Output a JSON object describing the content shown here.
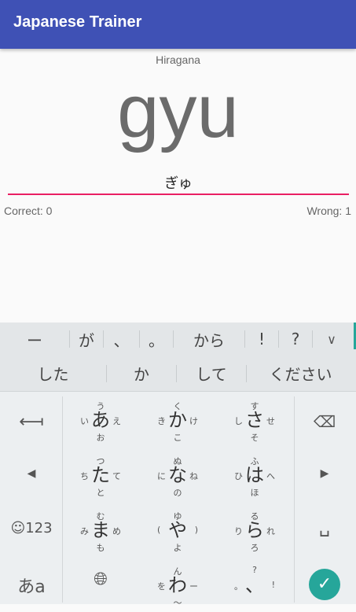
{
  "app": {
    "title": "Japanese Trainer"
  },
  "quiz": {
    "mode": "Hiragana",
    "romaji": "gyu",
    "answer_value": "ぎゅ",
    "correct_label": "Correct: 0",
    "wrong_label": "Wrong: 1"
  },
  "keyboard": {
    "candidates_row1": [
      "ー",
      "が",
      "、",
      "。",
      "から",
      "!",
      "?"
    ],
    "candidates_row2": [
      "した",
      "か",
      "して",
      "ください"
    ],
    "keys": [
      {
        "main": "あ",
        "up": "う",
        "left": "い",
        "right": "え",
        "down": "お"
      },
      {
        "main": "か",
        "up": "く",
        "left": "き",
        "right": "け",
        "down": "こ"
      },
      {
        "main": "さ",
        "up": "す",
        "left": "し",
        "right": "せ",
        "down": "そ"
      },
      {
        "main": "た",
        "up": "つ",
        "left": "ち",
        "right": "て",
        "down": "と"
      },
      {
        "main": "な",
        "up": "ぬ",
        "left": "に",
        "right": "ね",
        "down": "の"
      },
      {
        "main": "は",
        "up": "ふ",
        "left": "ひ",
        "right": "へ",
        "down": "ほ"
      },
      {
        "main": "ま",
        "up": "む",
        "left": "み",
        "right": "め",
        "down": "も"
      },
      {
        "main": "や",
        "up": "ゆ",
        "left": "(",
        "right": ")",
        "down": "よ"
      },
      {
        "main": "ら",
        "up": "る",
        "left": "り",
        "right": "れ",
        "down": "ろ"
      },
      {
        "main": "わ",
        "up": "ん",
        "left": "を",
        "right": "ー",
        "down": "〜"
      },
      {
        "main": "、",
        "up": "?",
        "left": "。",
        "right": "!",
        "down": ""
      }
    ],
    "emoji_label": "☺123",
    "kana_label": "あa",
    "icons": {
      "undo": "undo-arrow-icon",
      "left": "cursor-left-icon",
      "right": "cursor-right-icon",
      "backspace": "backspace-icon",
      "space": "space-icon",
      "globe": "globe-icon",
      "enter": "checkmark-icon",
      "collapse": "chevron-down-icon"
    },
    "accent_color": "#26a69a"
  },
  "colors": {
    "appbar": "#3f51b5",
    "underline": "#e91e63"
  }
}
